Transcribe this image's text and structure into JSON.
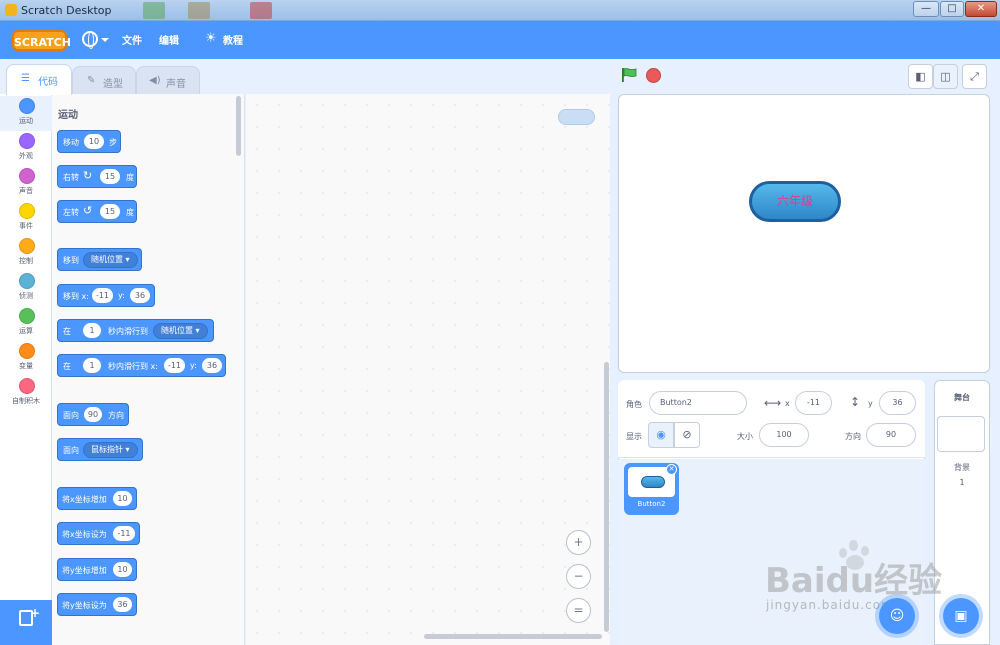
{
  "window": {
    "title": "Scratch Desktop",
    "controls": [
      "—",
      "□",
      "✕"
    ]
  },
  "menu": {
    "logo": "SCRATCH",
    "file": "文件",
    "edit": "编辑",
    "tutorials": "教程"
  },
  "tabs": [
    {
      "label": "代码",
      "icon": "code-icon"
    },
    {
      "label": "造型",
      "icon": "brush-icon"
    },
    {
      "label": "声音",
      "icon": "speaker-icon"
    }
  ],
  "categories": [
    {
      "label": "运动",
      "color": "#4c97ff"
    },
    {
      "label": "外观",
      "color": "#9966ff"
    },
    {
      "label": "声音",
      "color": "#cf63cf"
    },
    {
      "label": "事件",
      "color": "#ffd500"
    },
    {
      "label": "控制",
      "color": "#ffab19"
    },
    {
      "label": "侦测",
      "color": "#5cb1d6"
    },
    {
      "label": "运算",
      "color": "#59c059"
    },
    {
      "label": "变量",
      "color": "#ff8c1a"
    },
    {
      "label": "自制积木",
      "color": "#ff6680"
    }
  ],
  "palette": {
    "title": "运动",
    "move": {
      "a": "移动",
      "steps": "10",
      "b": "步"
    },
    "turn_right": {
      "a": "右转",
      "deg": "15",
      "b": "度"
    },
    "turn_left": {
      "a": "左转",
      "deg": "15",
      "b": "度"
    },
    "goto": {
      "a": "移到",
      "target": "随机位置"
    },
    "goto_xy": {
      "a": "移到 x:",
      "x": "-11",
      "b": "y:",
      "y": "36"
    },
    "glide": {
      "a": "在",
      "secs": "1",
      "b": "秒内滑行到",
      "target": "随机位置"
    },
    "glide_xy": {
      "a": "在",
      "secs": "1",
      "b": "秒内滑行到 x:",
      "x": "-11",
      "c": "y:",
      "y": "36"
    },
    "point_dir": {
      "a": "面向",
      "dir": "90",
      "b": "方向"
    },
    "point_towards": {
      "a": "面向",
      "target": "鼠标指针"
    },
    "change_x": {
      "a": "将x坐标增加",
      "v": "10"
    },
    "set_x": {
      "a": "将x坐标设为",
      "v": "-11"
    },
    "change_y": {
      "a": "将y坐标增加",
      "v": "10"
    },
    "set_y": {
      "a": "将y坐标设为",
      "v": "36"
    }
  },
  "zoom": {
    "in": "+",
    "out": "−",
    "reset": "="
  },
  "stage": {
    "sprite_text": "六年级"
  },
  "sprite_info": {
    "sprite_label": "角色",
    "sprite_name": "Button2",
    "x_label": "x",
    "x": "-11",
    "y_label": "y",
    "y": "36",
    "show_label": "显示",
    "size_label": "大小",
    "size": "100",
    "direction_label": "方向",
    "direction": "90"
  },
  "sprites": [
    {
      "name": "Button2"
    }
  ],
  "stage_panel": {
    "title": "舞台",
    "backdrops_label": "背景",
    "backdrops_count": "1"
  },
  "watermark": {
    "main": "Baidu经验",
    "sub": "jingyan.baidu.com"
  }
}
